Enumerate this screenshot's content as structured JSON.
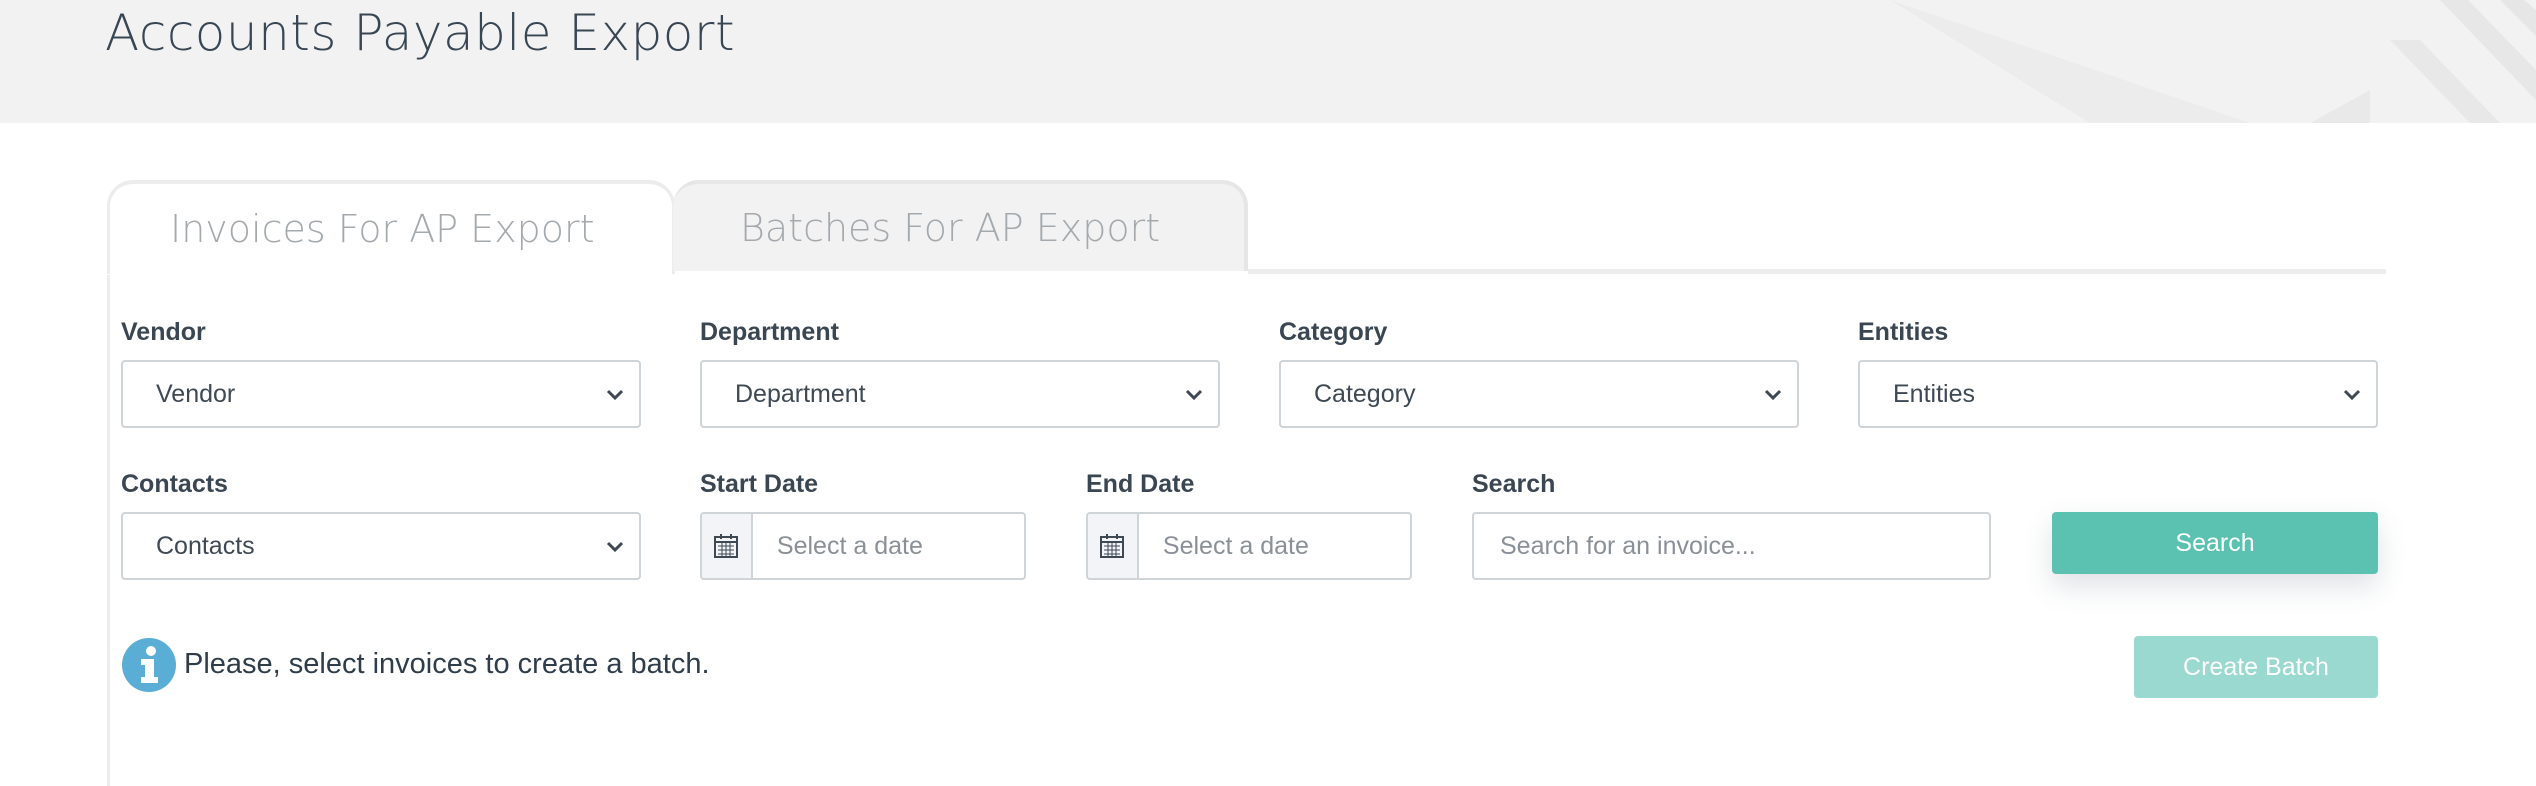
{
  "page": {
    "title": "Accounts Payable Export"
  },
  "tabs": [
    {
      "label": "Invoices For AP Export",
      "active": true
    },
    {
      "label": "Batches For AP Export",
      "active": false
    }
  ],
  "filters": {
    "vendor": {
      "label": "Vendor",
      "value": "Vendor"
    },
    "department": {
      "label": "Department",
      "value": "Department"
    },
    "category": {
      "label": "Category",
      "value": "Category"
    },
    "entities": {
      "label": "Entities",
      "value": "Entities"
    },
    "contacts": {
      "label": "Contacts",
      "value": "Contacts"
    },
    "start_date": {
      "label": "Start Date",
      "placeholder": "Select a date"
    },
    "end_date": {
      "label": "End Date",
      "placeholder": "Select a date"
    },
    "search": {
      "label": "Search",
      "placeholder": "Search for an invoice..."
    }
  },
  "buttons": {
    "search": "Search",
    "create_batch": "Create Batch"
  },
  "info": {
    "message": "Please, select invoices to create a batch.",
    "icon": "info-icon"
  },
  "colors": {
    "accent": "#5bc1b0",
    "accent_disabled": "#9ad9cf",
    "info_icon": "#5aaed6",
    "header_bg": "#f2f2f2"
  }
}
